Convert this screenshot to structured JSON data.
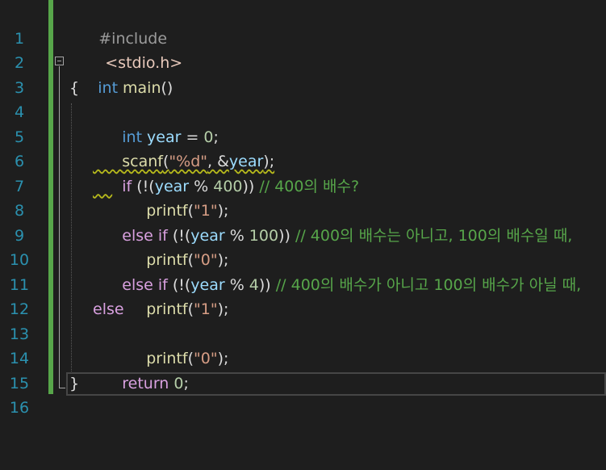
{
  "editor": {
    "line_numbers": [
      "1",
      "2",
      "3",
      "4",
      "5",
      "6",
      "7",
      "8",
      "9",
      "10",
      "11",
      "12",
      "13",
      "14",
      "15",
      "16"
    ],
    "colors": {
      "background": "#1e1e1e",
      "line_number": "#2b91af",
      "keyword": "#569cd6",
      "control": "#d8a0df",
      "string": "#d69d85",
      "variable": "#9cdcfe",
      "function": "#dcdcaa",
      "number": "#b5cea8",
      "comment": "#57a64a",
      "change_bar": "#57a64a"
    },
    "icons": {
      "fold": "collapse-minus-icon"
    },
    "code": {
      "l1": {
        "directive": "#include",
        "header": "<stdio.h>"
      },
      "l3": {
        "type": "int",
        "name": "main",
        "parens": "()"
      },
      "l4": {
        "brace": "{"
      },
      "l5": {
        "type": "int",
        "var": "year",
        "eq": " = ",
        "num": "0",
        "end": ";"
      },
      "l6": {
        "fn": "scanf",
        "open": "(",
        "fmt": "\"%d\"",
        "sep": ", &",
        "var": "year",
        "close": ");"
      },
      "l7": {
        "kw": "if",
        "p1": " (!(",
        "var": "year",
        "op": " % ",
        "num": "400",
        "p2": ")) ",
        "cmt": "// 400의 배수?"
      },
      "l8": {
        "fn": "printf",
        "open": "(",
        "str": "\"1\"",
        "close": ");"
      },
      "l9": {
        "kw1": "else",
        "kw2": "if",
        "p1": " (!(",
        "var": "year",
        "op": " % ",
        "num": "100",
        "p2": ")) ",
        "cmt": "// 400의 배수는 아니고, 100의 배수일 때,"
      },
      "l10": {
        "fn": "printf",
        "open": "(",
        "str": "\"0\"",
        "close": ");"
      },
      "l11": {
        "kw1": "else",
        "kw2": "if",
        "p1": " (!(",
        "var": "year",
        "op": " % ",
        "num": "4",
        "p2": ")) ",
        "cmt": "// 400의 배수가 아니고 100의 배수가 아닐 때,"
      },
      "l12": {
        "fn": "printf",
        "open": "(",
        "str": "\"1\"",
        "close": ");"
      },
      "l13": {
        "kw": "else"
      },
      "l14": {
        "fn": "printf",
        "open": "(",
        "str": "\"0\"",
        "close": ");"
      },
      "l15": {
        "kw": "return",
        "sp": " ",
        "num": "0",
        "end": ";"
      },
      "l16": {
        "brace": "}"
      }
    }
  }
}
